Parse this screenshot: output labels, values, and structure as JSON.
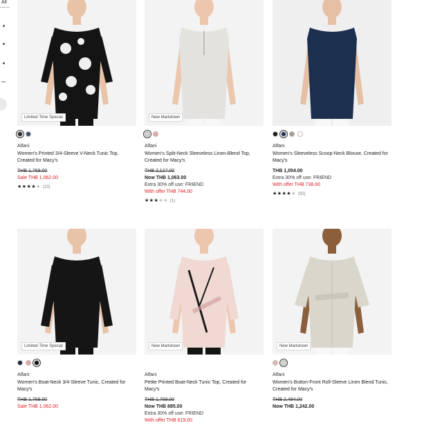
{
  "filter_rail": {
    "all_label": "All"
  },
  "products": [
    {
      "brand": "Alfani",
      "title": "Women's Printed 3/4-Sleeve V-Neck Tunic Top, Created for Macy's",
      "badge": "Limited-Time Special",
      "swatches": [
        {
          "color": "#2b2b2b",
          "selected": true
        },
        {
          "color": "#3a4d6b",
          "selected": false
        }
      ],
      "image_colors": {
        "bg": "#f3f3f3",
        "garment": "#141414",
        "accent": "#efefef",
        "skin": "#e8c3a8"
      },
      "prices": [
        {
          "text": "THB 1,769.00",
          "style": "strike"
        },
        {
          "text": "Sale THB 1,062.00",
          "style": "sale"
        }
      ],
      "rating": {
        "stars": 4,
        "count": "(23)"
      }
    },
    {
      "brand": "Alfani",
      "title": "Women's Split-Neck Sleeveless Linen-Blend Top, Created for Macy's",
      "badge": "New Markdown",
      "swatches": [
        {
          "color": "#cfcfcf",
          "selected": true
        },
        {
          "color": "#e8a6a6",
          "selected": false
        }
      ],
      "image_colors": {
        "bg": "#f3f3f3",
        "garment": "#e4e2de",
        "accent": "#d0cdc7",
        "skin": "#ecc7ad"
      },
      "prices": [
        {
          "text": "THB 2,127.00",
          "style": "strike"
        },
        {
          "text": "Now THB 1,063.00",
          "style": "now"
        },
        {
          "text": "Extra 30% off use: FRIEND",
          "style": "extra"
        },
        {
          "text": "With offer THB 744.00",
          "style": "offer"
        }
      ],
      "rating": {
        "stars": 3,
        "count": "(1)"
      }
    },
    {
      "brand": "Alfani",
      "title": "Women's Sleeveless Scoop-Neck Blouse, Created for Macy's",
      "badge": "",
      "swatches": [
        {
          "color": "#1a1a1a",
          "selected": false
        },
        {
          "color": "#1d3557",
          "selected": true
        },
        {
          "color": "#a89a92",
          "selected": false
        },
        {
          "color": "#ffffff",
          "selected": false
        }
      ],
      "image_colors": {
        "bg": "#efefef",
        "garment": "#1c2f4f",
        "accent": "#243a60",
        "skin": "#e6c0a5"
      },
      "prices": [
        {
          "text": "THB 1,054.00",
          "style": "now"
        },
        {
          "text": "Extra 30% off use: FRIEND",
          "style": "extra"
        },
        {
          "text": "With offer THB 738.00",
          "style": "offer"
        }
      ],
      "rating": {
        "stars": 4,
        "count": "(92)"
      }
    },
    {
      "brand": "Alfani",
      "title": "Women's Boat-Neck 3/4-Sleeve Tunic, Created for Macy's",
      "badge": "Limited-Time Special",
      "swatches": [
        {
          "color": "#1f2a3a",
          "selected": false
        },
        {
          "color": "#e8a0a0",
          "selected": false
        },
        {
          "color": "#111111",
          "selected": true
        }
      ],
      "image_colors": {
        "bg": "#f3f3f3",
        "garment": "#151515",
        "accent": "#2a2a2a",
        "skin": "#e8c3a8"
      },
      "prices": [
        {
          "text": "THB 1,769.00",
          "style": "strike"
        },
        {
          "text": "Sale THB 1,062.00",
          "style": "sale"
        }
      ],
      "rating": null
    },
    {
      "brand": "Alfani",
      "title": "Petite Printed Boat-Neck Tunic Top, Created for Macy's",
      "badge": "New Markdown",
      "swatches": [],
      "image_colors": {
        "bg": "#f3f3f3",
        "garment": "#f0d9d3",
        "accent": "#1a1a1a",
        "skin": "#ecc7ad"
      },
      "prices": [
        {
          "text": "THB 1,769.00",
          "style": "strike"
        },
        {
          "text": "Now THB 885.00",
          "style": "now"
        },
        {
          "text": "Extra 30% off use: FRIEND",
          "style": "extra"
        },
        {
          "text": "With offer THB 619.00",
          "style": "offer"
        }
      ],
      "rating": null
    },
    {
      "brand": "Alfani",
      "title": "Women's Button-Front Roll-Sleeve Linen Blend Tunic, Created for Macy's",
      "badge": "New Markdown",
      "swatches": [
        {
          "color": "#e3b6b0",
          "selected": false
        },
        {
          "color": "#d8d4cc",
          "selected": true
        }
      ],
      "image_colors": {
        "bg": "#f3f3f3",
        "garment": "#d9d6cc",
        "accent": "#c4c0b5",
        "skin": "#8b5e3c"
      },
      "prices": [
        {
          "text": "THB 2,484.00",
          "style": "strike"
        },
        {
          "text": "Now THB 1,242.00",
          "style": "now"
        }
      ],
      "rating": null
    }
  ]
}
